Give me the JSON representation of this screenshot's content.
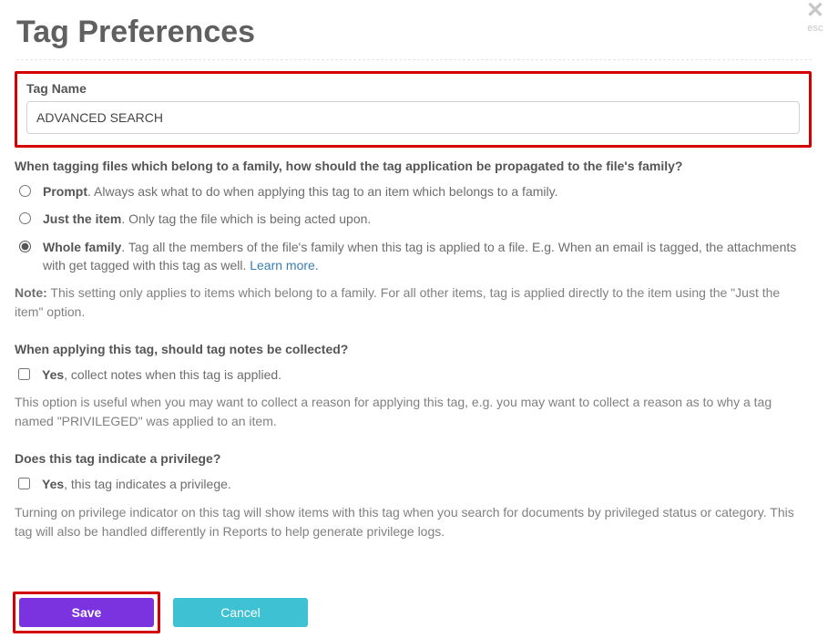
{
  "header": {
    "title": "Tag Preferences",
    "esc_label": "esc"
  },
  "tag_name": {
    "label": "Tag Name",
    "value": "ADVANCED SEARCH"
  },
  "propagation": {
    "question": "When tagging files which belong to a family, how should the tag application be propagated to the file's family?",
    "options": {
      "prompt": {
        "title": "Prompt",
        "desc": ". Always ask what to do when applying this tag to an item which belongs to a family."
      },
      "just_item": {
        "title": "Just the item",
        "desc": ". Only tag the file which is being acted upon."
      },
      "whole_family": {
        "title": "Whole family",
        "desc": ". Tag all the members of the file's family when this tag is applied to a file. E.g. When an email is tagged, the attachments with get tagged with this tag as well. ",
        "learn_more": "Learn more"
      }
    },
    "selected": "whole_family",
    "note_prefix": "Note:",
    "note": " This setting only applies to items which belong to a family. For all other items, tag is applied directly to the item using the \"Just the item\" option."
  },
  "notes": {
    "question": "When applying this tag, should tag notes be collected?",
    "checkbox_title": "Yes",
    "checkbox_desc": ", collect notes when this tag is applied.",
    "checked": false,
    "helper": "This option is useful when you may want to collect a reason for applying this tag, e.g. you may want to collect a reason as to why a tag named \"PRIVILEGED\" was applied to an item."
  },
  "privilege": {
    "question": "Does this tag indicate a privilege?",
    "checkbox_title": "Yes",
    "checkbox_desc": ", this tag indicates a privilege.",
    "checked": false,
    "helper": "Turning on privilege indicator on this tag will show items with this tag when you search for documents by privileged status or category. This tag will also be handled differently in Reports to help generate privilege logs."
  },
  "footer": {
    "save_label": "Save",
    "cancel_label": "Cancel"
  }
}
